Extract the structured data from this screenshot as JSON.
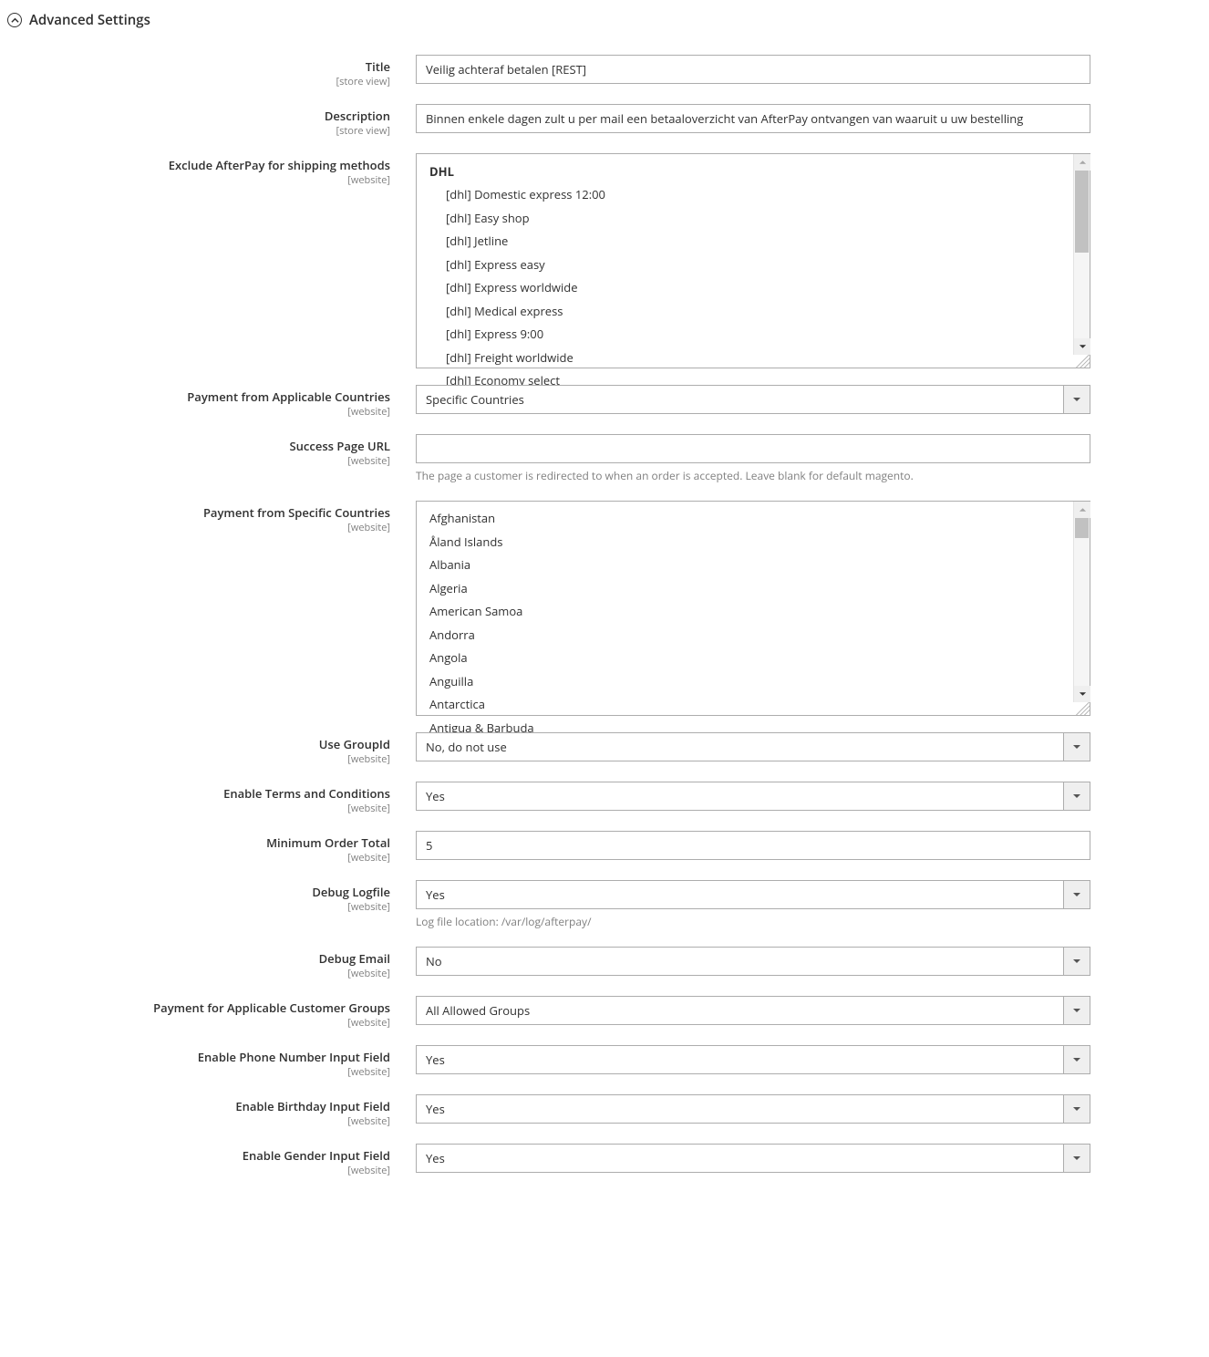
{
  "section": {
    "title": "Advanced Settings"
  },
  "scopes": {
    "store_view": "[store view]",
    "website": "[website]"
  },
  "fields": {
    "title": {
      "label": "Title",
      "value": "Veilig achteraf betalen [REST]"
    },
    "description": {
      "label": "Description",
      "value": "Binnen enkele dagen zult u per mail een betaaloverzicht van AfterPay ontvangen van waaruit u uw bestelling"
    },
    "exclude_shipping": {
      "label": "Exclude AfterPay for shipping methods",
      "group": "DHL",
      "items": [
        "[dhl] Domestic express 12:00",
        "[dhl] Easy shop",
        "[dhl] Jetline",
        "[dhl] Express easy",
        "[dhl] Express worldwide",
        "[dhl] Medical express",
        "[dhl] Express 9:00",
        "[dhl] Freight worldwide",
        "[dhl] Economy select"
      ]
    },
    "applicable_countries": {
      "label": "Payment from Applicable Countries",
      "value": "Specific Countries"
    },
    "success_url": {
      "label": "Success Page URL",
      "value": "",
      "hint": "The page a customer is redirected to when an order is accepted. Leave blank for default magento."
    },
    "specific_countries": {
      "label": "Payment from Specific Countries",
      "items": [
        "Afghanistan",
        "Åland Islands",
        "Albania",
        "Algeria",
        "American Samoa",
        "Andorra",
        "Angola",
        "Anguilla",
        "Antarctica",
        "Antigua & Barbuda"
      ]
    },
    "use_groupid": {
      "label": "Use GroupId",
      "value": "No, do not use"
    },
    "enable_terms": {
      "label": "Enable Terms and Conditions",
      "value": "Yes"
    },
    "min_order_total": {
      "label": "Minimum Order Total",
      "value": "5"
    },
    "debug_logfile": {
      "label": "Debug Logfile",
      "value": "Yes",
      "hint": "Log file location: /var/log/afterpay/"
    },
    "debug_email": {
      "label": "Debug Email",
      "value": "No"
    },
    "customer_groups": {
      "label": "Payment for Applicable Customer Groups",
      "value": "All Allowed Groups"
    },
    "enable_phone": {
      "label": "Enable Phone Number Input Field",
      "value": "Yes"
    },
    "enable_birthday": {
      "label": "Enable Birthday Input Field",
      "value": "Yes"
    },
    "enable_gender": {
      "label": "Enable Gender Input Field",
      "value": "Yes"
    }
  }
}
